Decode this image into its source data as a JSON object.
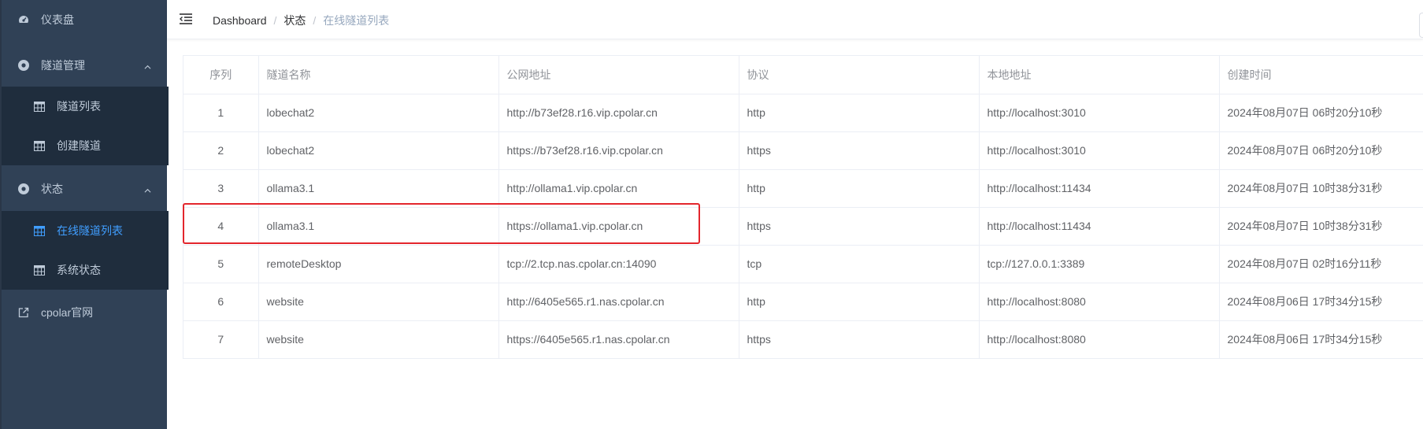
{
  "sidebar": {
    "items": [
      {
        "label": "仪表盘",
        "icon": "dashboard-icon"
      },
      {
        "label": "隧道管理",
        "icon": "tunnel-gear-icon",
        "children": [
          {
            "label": "隧道列表",
            "icon": "table-icon"
          },
          {
            "label": "创建隧道",
            "icon": "table-icon"
          }
        ]
      },
      {
        "label": "状态",
        "icon": "status-gear-icon",
        "children": [
          {
            "label": "在线隧道列表",
            "icon": "table-icon",
            "active": true
          },
          {
            "label": "系统状态",
            "icon": "table-icon"
          }
        ]
      },
      {
        "label": "cpolar官网",
        "icon": "external-link-icon"
      }
    ]
  },
  "breadcrumb": {
    "items": [
      "Dashboard",
      "状态",
      "在线隧道列表"
    ],
    "separator": "/"
  },
  "table": {
    "headers": [
      "序列",
      "隧道名称",
      "公网地址",
      "协议",
      "本地地址",
      "创建时间"
    ],
    "rows": [
      [
        "1",
        "lobechat2",
        "http://b73ef28.r16.vip.cpolar.cn",
        "http",
        "http://localhost:3010",
        "2024年08月07日 06时20分10秒"
      ],
      [
        "2",
        "lobechat2",
        "https://b73ef28.r16.vip.cpolar.cn",
        "https",
        "http://localhost:3010",
        "2024年08月07日 06时20分10秒"
      ],
      [
        "3",
        "ollama3.1",
        "http://ollama1.vip.cpolar.cn",
        "http",
        "http://localhost:11434",
        "2024年08月07日 10时38分31秒"
      ],
      [
        "4",
        "ollama3.1",
        "https://ollama1.vip.cpolar.cn",
        "https",
        "http://localhost:11434",
        "2024年08月07日 10时38分31秒"
      ],
      [
        "5",
        "remoteDesktop",
        "tcp://2.tcp.nas.cpolar.cn:14090",
        "tcp",
        "tcp://127.0.0.1:3389",
        "2024年08月07日 02时16分11秒"
      ],
      [
        "6",
        "website",
        "http://6405e565.r1.nas.cpolar.cn",
        "http",
        "http://localhost:8080",
        "2024年08月06日 17时34分15秒"
      ],
      [
        "7",
        "website",
        "https://6405e565.r1.nas.cpolar.cn",
        "https",
        "http://localhost:8080",
        "2024年08月06日 17时34分15秒"
      ]
    ],
    "highlighted_row": 4
  },
  "colors": {
    "sidebar_bg": "#304156",
    "submenu_bg": "#1f2d3d",
    "sidebar_text": "#bfcbd9",
    "active_text": "#409eff",
    "highlight_border": "#e3262d"
  }
}
